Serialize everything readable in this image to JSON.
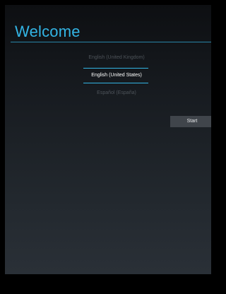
{
  "header": {
    "title": "Welcome"
  },
  "language_picker": {
    "options": [
      {
        "label": "English (United Kingdom)",
        "selected": false
      },
      {
        "label": "English (United States)",
        "selected": true
      },
      {
        "label": "Español (España)",
        "selected": false
      }
    ]
  },
  "actions": {
    "start_label": "Start"
  },
  "colors": {
    "accent": "#33b5e5",
    "background_top": "#0d0f12",
    "background_bottom": "#2a3037",
    "button": "#40454b",
    "dim_text": "#4e545a"
  }
}
